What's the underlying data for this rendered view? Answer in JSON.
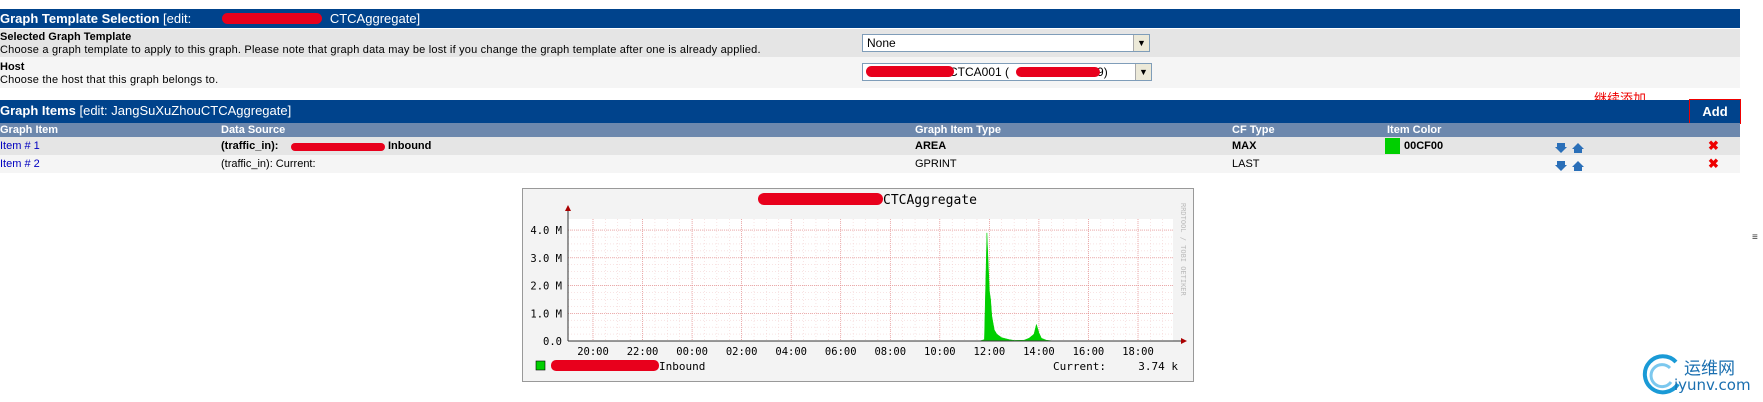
{
  "template_section": {
    "title": "Graph Template Selection",
    "edit_prefix": "[edit: ",
    "edit_suffix": "CTCAggregate]"
  },
  "selected_template": {
    "label": "Selected Graph Template",
    "description": "Choose a graph template to apply to this graph. Please note that graph data may be lost if you change the graph template after one is already applied.",
    "value": "None"
  },
  "host": {
    "label": "Host",
    "description": "Choose the host that this graph belongs to.",
    "value_visible": "CTCA001 (",
    "value_end": "9)"
  },
  "annotation": "继续添加",
  "items_section": {
    "title": "Graph Items",
    "edit": "[edit: JangSuXuZhouCTCAggregate]",
    "add_label": "Add"
  },
  "columns": [
    "Graph Item",
    "Data Source",
    "Graph Item Type",
    "CF Type",
    "Item Color"
  ],
  "items": [
    {
      "name": "Item # 1",
      "source_prefix": "(traffic_in):",
      "source_suffix": "Inbound",
      "type": "AREA",
      "cf": "MAX",
      "color_hex": "00CF00",
      "bold": true
    },
    {
      "name": "Item # 2",
      "source_prefix": "(traffic_in): Current:",
      "source_suffix": "",
      "type": "GPRINT",
      "cf": "LAST",
      "color_hex": "",
      "bold": false
    }
  ],
  "chart_data": {
    "type": "area",
    "title_suffix": "CTCAggregate",
    "y_ticks": [
      "4.0 M",
      "3.0 M",
      "2.0 M",
      "1.0 M",
      "0.0"
    ],
    "x_ticks": [
      "20:00",
      "22:00",
      "00:00",
      "02:00",
      "04:00",
      "06:00",
      "08:00",
      "10:00",
      "12:00",
      "14:00",
      "16:00",
      "18:00"
    ],
    "ylim": [
      0,
      4.4
    ],
    "series": [
      {
        "name": "Inbound",
        "color": "#00CF00",
        "x": [
          11.6,
          11.8,
          11.9,
          12.0,
          12.05,
          12.1,
          12.2,
          12.3,
          12.5,
          12.8,
          13.0,
          13.4,
          13.6,
          13.8,
          13.9,
          14.0,
          14.1,
          14.3,
          14.6
        ],
        "values": [
          0,
          0.05,
          3.9,
          1.8,
          1.5,
          0.9,
          0.4,
          0.25,
          0.12,
          0.05,
          0.02,
          0.03,
          0.1,
          0.25,
          0.6,
          0.3,
          0.1,
          0.03,
          0
        ]
      }
    ],
    "legend_label": "Inbound",
    "current_label": "Current:",
    "current_value": "3.74 k",
    "watermark": "RRDTOOL / TOBI OETIKER"
  },
  "site_logo": {
    "name": "运维网",
    "url": "iyunv.com"
  }
}
